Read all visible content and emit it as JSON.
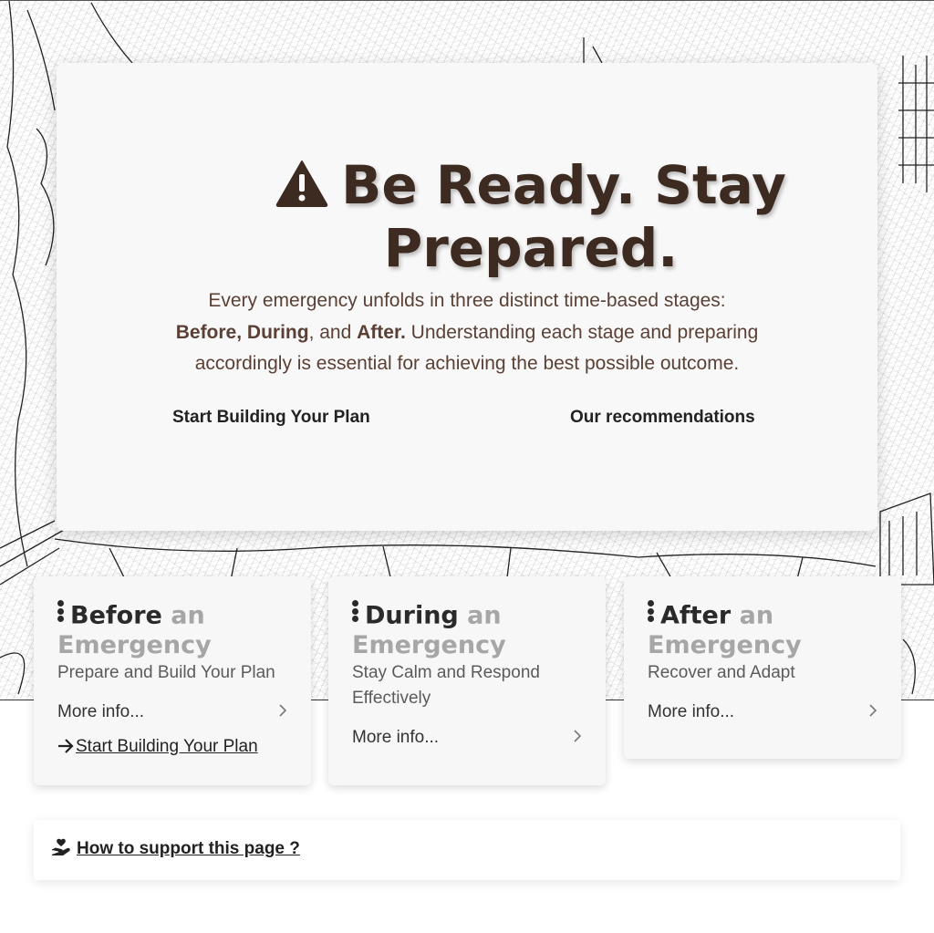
{
  "hero": {
    "title": "Be Ready. Stay Prepared.",
    "description_line1": "Every emergency unfolds in three distinct time-based stages:",
    "stage_before": "Before,",
    "stage_during": "During",
    "and_text": ", and",
    "stage_after": "After.",
    "description_rest": "Understanding each stage and preparing accordingly is essential for achieving the best possible outcome.",
    "button_plan": "Start Building Your Plan",
    "button_recommendations": "Our recommendations",
    "icon": "warning-triangle-icon"
  },
  "stages": [
    {
      "title_main": "Before",
      "title_muted": "an Emergency",
      "subtitle": "Prepare and Build Your Plan",
      "more": "More info...",
      "link": "Start Building Your Plan"
    },
    {
      "title_main": "During",
      "title_muted": "an Emergency",
      "subtitle": "Stay Calm and Respond Effectively",
      "more": "More info..."
    },
    {
      "title_main": "After",
      "title_muted": "an Emergency",
      "subtitle": "Recover and Adapt",
      "more": "More info..."
    }
  ],
  "support": {
    "label": "How to support this page ?",
    "icon": "hand-holding-heart-icon"
  },
  "colors": {
    "title": "#3d2a20",
    "text": "#5a4035",
    "muted": "#a6a6a6"
  }
}
